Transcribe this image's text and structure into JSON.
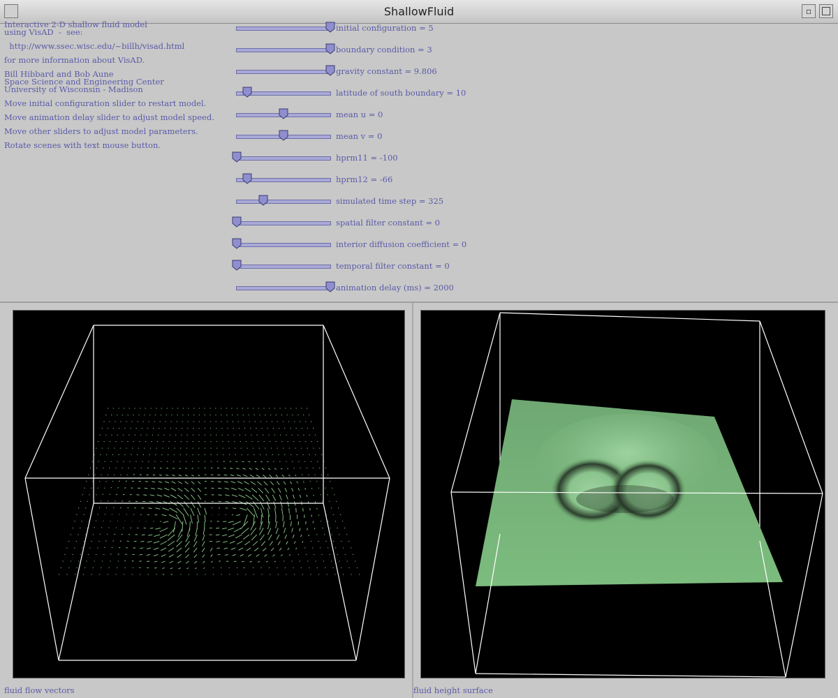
{
  "window": {
    "title": "ShallowFluid",
    "restore_glyph": "▫"
  },
  "info_lines": [
    "Interactive 2-D shallow fluid model",
    "using VisAD  -  see:",
    "",
    "  http://www.ssec.wisc.edu/~billh/visad.html",
    "",
    "for more information about VisAD.",
    "",
    "Bill Hibbard and Bob Aune",
    "Space Science and Engineering Center",
    "University of Wisconsin - Madison",
    "",
    "Move initial configuration slider to restart model.",
    "",
    "Move animation delay slider to adjust model speed.",
    "",
    "Move other sliders to adjust model parameters.",
    "",
    "Rotate scenes with text mouse button."
  ],
  "sliders": [
    {
      "label": "initial configuration = 5",
      "position": 1.0
    },
    {
      "label": "boundary condition = 3",
      "position": 1.0
    },
    {
      "label": "gravity constant = 9.806",
      "position": 1.0
    },
    {
      "label": "latitude of south boundary = 10",
      "position": 0.11
    },
    {
      "label": "mean u = 0",
      "position": 0.5
    },
    {
      "label": "mean v = 0",
      "position": 0.5
    },
    {
      "label": "hprm11 = -100",
      "position": 0.0
    },
    {
      "label": "hprm12 = -66",
      "position": 0.11
    },
    {
      "label": "simulated time step = 325",
      "position": 0.28
    },
    {
      "label": "spatial filter constant = 0",
      "position": 0.0
    },
    {
      "label": "interior diffusion coefficient = 0",
      "position": 0.0
    },
    {
      "label": "temporal filter constant = 0",
      "position": 0.0
    },
    {
      "label": "animation delay (ms) = 2000",
      "position": 1.0
    }
  ],
  "views": {
    "left_label": "fluid flow vectors",
    "right_label": "fluid height surface"
  },
  "colors": {
    "slider_text": "#5a5aa8",
    "vector_color": "#8fd08f",
    "surface_color": "#78b67a",
    "frame_line": "#ffffff",
    "viewport_bg": "#000000"
  }
}
